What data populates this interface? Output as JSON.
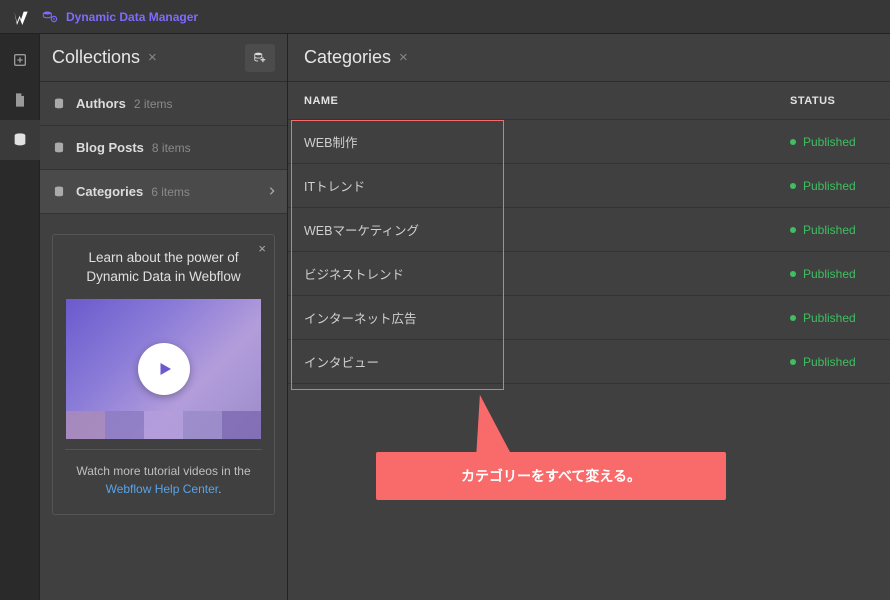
{
  "topbar": {
    "title": "Dynamic Data Manager"
  },
  "collections_panel": {
    "title": "Collections",
    "items": [
      {
        "name": "Authors",
        "count": "2 items",
        "active": false
      },
      {
        "name": "Blog Posts",
        "count": "8 items",
        "active": false
      },
      {
        "name": "Categories",
        "count": "6 items",
        "active": true
      }
    ]
  },
  "promo": {
    "title_line1": "Learn about the power of",
    "title_line2": "Dynamic Data in Webflow",
    "sub_text": "Watch more tutorial videos in the",
    "link_text": "Webflow Help Center",
    "link_suffix": "."
  },
  "main_panel": {
    "title": "Categories",
    "columns": {
      "name": "NAME",
      "status": "STATUS"
    },
    "rows": [
      {
        "name": "WEB制作",
        "status": "Published"
      },
      {
        "name": "ITトレンド",
        "status": "Published"
      },
      {
        "name": "WEBマーケティング",
        "status": "Published"
      },
      {
        "name": "ビジネストレンド",
        "status": "Published"
      },
      {
        "name": "インターネット広告",
        "status": "Published"
      },
      {
        "name": "インタビュー",
        "status": "Published"
      }
    ]
  },
  "annotation": {
    "callout": "カテゴリーをすべて変える。"
  },
  "colors": {
    "accent_purple": "#7c6cff",
    "status_green": "#3fbf62",
    "annotation_red": "#f96a6a",
    "link_blue": "#5aa3e8"
  }
}
